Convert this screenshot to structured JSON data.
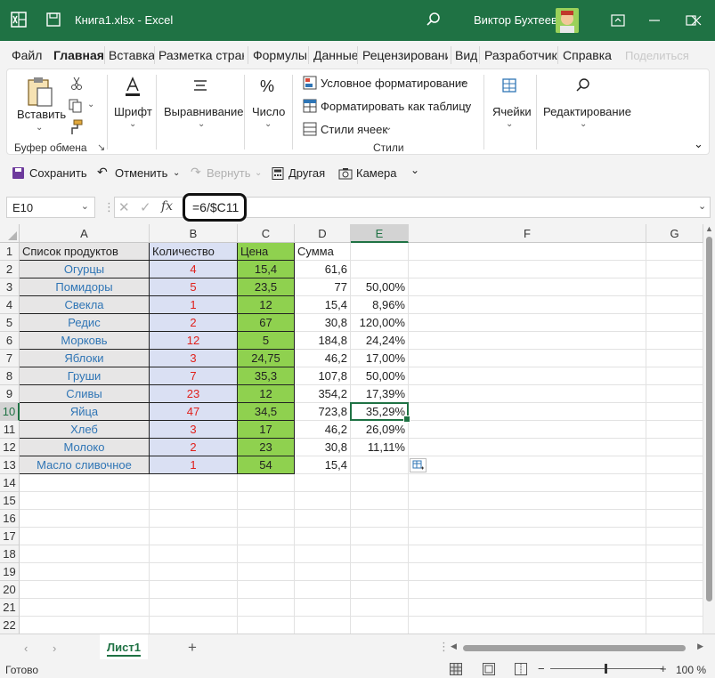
{
  "titlebar": {
    "document": "Книга1.xlsx  -  Excel",
    "user": "Виктор Бухтеев",
    "icons": [
      "excel-logo-icon",
      "save-icon",
      "search-icon",
      "ribbon-display-icon",
      "minimize-icon",
      "maximize-icon",
      "close-icon"
    ]
  },
  "menu": {
    "tabs": [
      "Файл",
      "Главная",
      "Вставка",
      "Разметка страни",
      "Формулы",
      "Данные",
      "Рецензирование",
      "Вид",
      "Разработчик",
      "Справка"
    ],
    "active": "Главная",
    "share": "Поделиться"
  },
  "ribbon": {
    "paste": "Вставить",
    "clipboard_group": "Буфер обмена",
    "font": "Шрифт",
    "alignment": "Выравнивание",
    "number": "Число",
    "conditional": "Условное форматирование",
    "format_table": "Форматировать как таблицу",
    "cell_styles": "Стили ячеек",
    "styles_group": "Стили",
    "cells": "Ячейки",
    "editing": "Редактирование"
  },
  "qat": {
    "save": "Сохранить",
    "undo": "Отменить",
    "redo": "Вернуть",
    "other": "Другая",
    "camera": "Камера"
  },
  "formula_bar": {
    "name_box": "E10",
    "formula": "=6/$C11"
  },
  "sheet": {
    "columns": [
      "A",
      "B",
      "C",
      "D",
      "E",
      "F",
      "G"
    ],
    "selected_column": "E",
    "selected_row": "10",
    "header_row": [
      "Список продуктов",
      "Количество",
      "Цена",
      "Сумма",
      ""
    ],
    "rows": [
      {
        "n": "2",
        "a": "Огурцы",
        "b": "4",
        "c": "15,4",
        "d": "61,6",
        "e": ""
      },
      {
        "n": "3",
        "a": "Помидоры",
        "b": "5",
        "c": "23,5",
        "d": "77",
        "e": "50,00%"
      },
      {
        "n": "4",
        "a": "Свекла",
        "b": "1",
        "c": "12",
        "d": "15,4",
        "e": "8,96%"
      },
      {
        "n": "5",
        "a": "Редис",
        "b": "2",
        "c": "67",
        "d": "30,8",
        "e": "120,00%"
      },
      {
        "n": "6",
        "a": "Морковь",
        "b": "12",
        "c": "5",
        "d": "184,8",
        "e": "24,24%"
      },
      {
        "n": "7",
        "a": "Яблоки",
        "b": "3",
        "c": "24,75",
        "d": "46,2",
        "e": "17,00%"
      },
      {
        "n": "8",
        "a": "Груши",
        "b": "7",
        "c": "35,3",
        "d": "107,8",
        "e": "50,00%"
      },
      {
        "n": "9",
        "a": "Сливы",
        "b": "23",
        "c": "12",
        "d": "354,2",
        "e": "17,39%"
      },
      {
        "n": "10",
        "a": "Яйца",
        "b": "47",
        "c": "34,5",
        "d": "723,8",
        "e": "35,29%"
      },
      {
        "n": "11",
        "a": "Хлеб",
        "b": "3",
        "c": "17",
        "d": "46,2",
        "e": "26,09%"
      },
      {
        "n": "12",
        "a": "Молоко",
        "b": "2",
        "c": "23",
        "d": "30,8",
        "e": "11,11%"
      },
      {
        "n": "13",
        "a": "Масло сливочное",
        "b": "1",
        "c": "54",
        "d": "15,4",
        "e": ""
      }
    ],
    "empty_rows": [
      "14",
      "15",
      "16",
      "17",
      "18",
      "19",
      "20",
      "21",
      "22"
    ]
  },
  "sheet_tabs": {
    "active": "Лист1",
    "add": "+"
  },
  "status": {
    "text": "Готово",
    "zoom": "100 %"
  },
  "colors": {
    "accent": "#1f7244",
    "col_a_fill": "#e7e6e6",
    "col_b_fill": "#dae0f3",
    "col_c_fill": "#8fd14f",
    "name_text": "#2f75b5",
    "qty_text": "#e0211c"
  }
}
